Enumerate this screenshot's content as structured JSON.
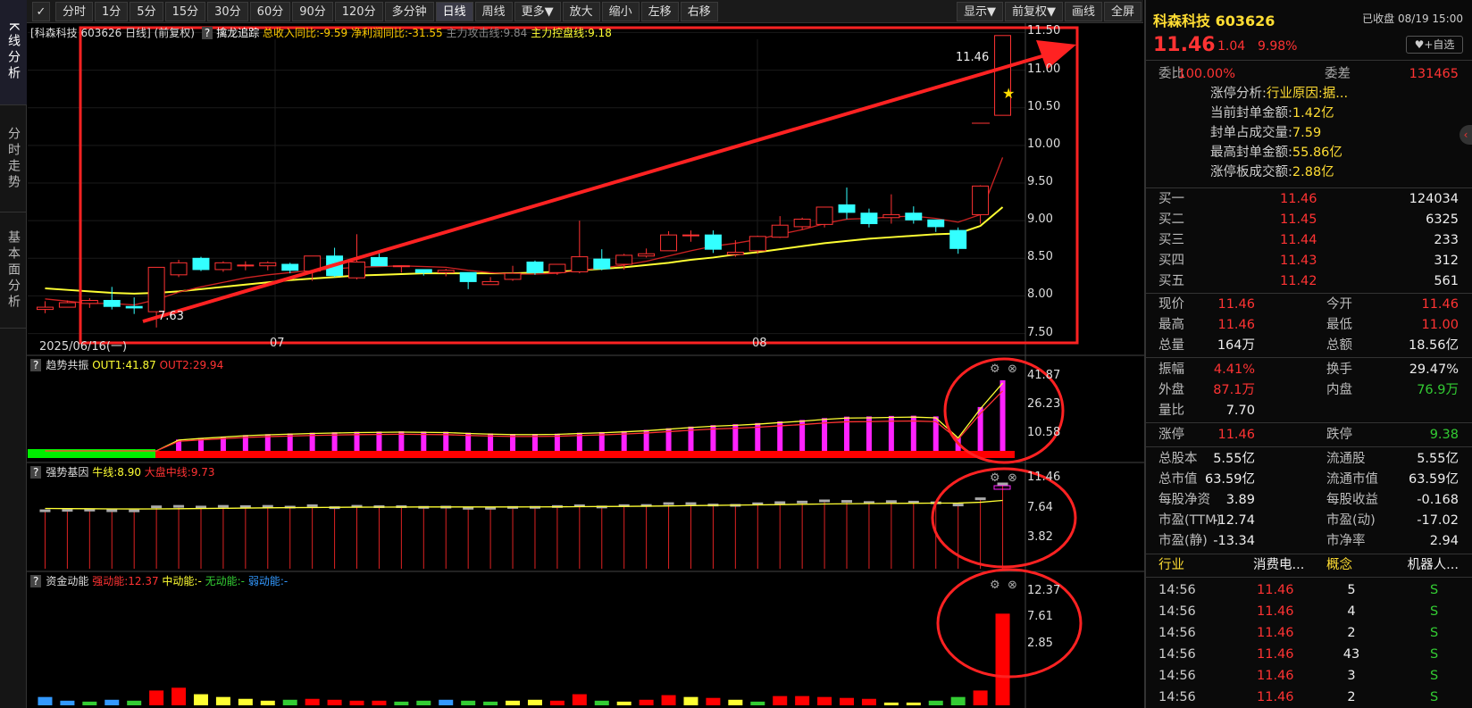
{
  "left_tabs": [
    "K线分析",
    "分时走势",
    "基本面分析"
  ],
  "toolbar": {
    "icon": "✓",
    "periods": [
      "分时",
      "1分",
      "5分",
      "15分",
      "30分",
      "60分",
      "90分",
      "120分",
      "多分钟",
      "日线",
      "周线",
      "更多▼",
      "放大",
      "缩小",
      "左移",
      "右移"
    ],
    "selected": "日线",
    "right": [
      "显示▼",
      "前复权▼",
      "画线",
      "全屏"
    ]
  },
  "main_chart": {
    "title": "[科森科技 603626 日线]",
    "adjust": "(前复权)",
    "help": "?",
    "indicator": "擒龙追踪",
    "items": [
      {
        "label": "总收入同比:-9.59",
        "color": "#ffcc00"
      },
      {
        "label": "净利润同比:-31.55",
        "color": "#ffcc00"
      },
      {
        "label": "主力攻击线:9.84",
        "color": "#888888"
      },
      {
        "label": "主力控盘线:9.18",
        "color": "#ffff33"
      }
    ],
    "y_ticks": [
      "11.50",
      "11.00",
      "10.50",
      "10.00",
      "9.50",
      "9.00",
      "8.50",
      "8.00",
      "7.50"
    ],
    "high_label": "11.46",
    "low_label": "7.63",
    "x_labels": [
      "2025/06/16(一)",
      "07",
      "08"
    ]
  },
  "sub1": {
    "help": "?",
    "name": "趋势共振",
    "items": [
      {
        "label": "OUT1:41.87",
        "color": "#ffff33"
      },
      {
        "label": "OUT2:29.94",
        "color": "#ff3333"
      }
    ],
    "y_ticks": [
      "41.87",
      "26.23",
      "10.58"
    ]
  },
  "sub2": {
    "help": "?",
    "name": "强势基因",
    "items": [
      {
        "label": "牛线:8.90",
        "color": "#ffff33"
      },
      {
        "label": "大盘中线:9.73",
        "color": "#ff3333"
      }
    ],
    "y_ticks": [
      "11.46",
      "7.64",
      "3.82"
    ]
  },
  "sub3": {
    "help": "?",
    "name": "资金动能",
    "items": [
      {
        "label": "强动能:12.37",
        "color": "#ff3333"
      },
      {
        "label": "中动能:-",
        "color": "#ffff33"
      },
      {
        "label": "无动能:-",
        "color": "#33cc33"
      },
      {
        "label": "弱动能:-",
        "color": "#3399ff"
      }
    ],
    "y_ticks": [
      "12.37",
      "7.61",
      "2.85"
    ]
  },
  "chart_data": {
    "type": "candlestick",
    "x_labels": [
      "2025/06/16(一)",
      "07",
      "08"
    ],
    "ohlc": [
      [
        7.82,
        7.85,
        7.77,
        7.93
      ],
      [
        7.85,
        7.91,
        7.85,
        7.94
      ],
      [
        7.9,
        7.94,
        7.84,
        7.97
      ],
      [
        7.94,
        7.86,
        7.82,
        8.12
      ],
      [
        7.86,
        7.84,
        7.76,
        7.98
      ],
      [
        7.79,
        8.38,
        7.58,
        8.38
      ],
      [
        8.28,
        8.44,
        8.25,
        8.48
      ],
      [
        8.5,
        8.35,
        8.33,
        8.52
      ],
      [
        8.35,
        8.44,
        8.32,
        8.46
      ],
      [
        8.4,
        8.41,
        8.34,
        8.46
      ],
      [
        8.4,
        8.44,
        8.34,
        8.46
      ],
      [
        8.42,
        8.34,
        8.3,
        8.44
      ],
      [
        8.33,
        8.53,
        8.2,
        8.53
      ],
      [
        8.53,
        8.27,
        8.25,
        8.64
      ],
      [
        8.24,
        8.45,
        8.22,
        8.82
      ],
      [
        8.51,
        8.4,
        8.4,
        8.59
      ],
      [
        8.39,
        8.4,
        8.31,
        8.4
      ],
      [
        8.35,
        8.31,
        8.27,
        8.35
      ],
      [
        8.31,
        8.34,
        8.26,
        8.36
      ],
      [
        8.31,
        8.19,
        8.09,
        8.31
      ],
      [
        8.15,
        8.19,
        8.15,
        8.25
      ],
      [
        8.22,
        8.3,
        8.2,
        8.4
      ],
      [
        8.45,
        8.31,
        8.28,
        8.47
      ],
      [
        8.31,
        8.42,
        8.28,
        8.42
      ],
      [
        8.32,
        8.52,
        8.3,
        9.0
      ],
      [
        8.49,
        8.36,
        8.34,
        8.62
      ],
      [
        8.42,
        8.54,
        8.35,
        8.56
      ],
      [
        8.53,
        8.56,
        8.51,
        8.63
      ],
      [
        8.6,
        8.81,
        8.6,
        8.86
      ],
      [
        8.81,
        8.81,
        8.72,
        8.87
      ],
      [
        8.81,
        8.62,
        8.57,
        8.87
      ],
      [
        8.55,
        8.58,
        8.52,
        8.74
      ],
      [
        8.6,
        8.79,
        8.56,
        8.8
      ],
      [
        8.78,
        8.94,
        8.77,
        9.06
      ],
      [
        8.92,
        9.02,
        8.88,
        9.04
      ],
      [
        8.95,
        9.18,
        8.91,
        9.18
      ],
      [
        9.21,
        9.11,
        9.02,
        9.44
      ],
      [
        9.1,
        8.96,
        8.91,
        9.16
      ],
      [
        9.04,
        9.08,
        8.96,
        9.35
      ],
      [
        9.1,
        9.01,
        8.96,
        9.19
      ],
      [
        9.01,
        8.92,
        8.85,
        9.01
      ],
      [
        8.87,
        8.63,
        8.56,
        8.91
      ],
      [
        9.08,
        9.46,
        8.96,
        9.47
      ],
      [
        10.4,
        11.46,
        11.0,
        11.46
      ]
    ],
    "ma_fast": [
      7.96,
      7.93,
      7.9,
      7.9,
      7.88,
      7.95,
      8.05,
      8.12,
      8.18,
      8.24,
      8.28,
      8.31,
      8.34,
      8.36,
      8.38,
      8.39,
      8.4,
      8.39,
      8.38,
      8.34,
      8.31,
      8.29,
      8.29,
      8.3,
      8.34,
      8.37,
      8.41,
      8.46,
      8.53,
      8.6,
      8.66,
      8.7,
      8.75,
      8.82,
      8.88,
      8.96,
      9.02,
      9.03,
      9.05,
      9.06,
      9.03,
      8.98,
      9.08,
      9.84
    ],
    "ma_slow": [
      8.1,
      8.08,
      8.06,
      8.04,
      8.03,
      8.04,
      8.06,
      8.09,
      8.12,
      8.15,
      8.18,
      8.21,
      8.23,
      8.25,
      8.27,
      8.28,
      8.29,
      8.3,
      8.3,
      8.3,
      8.3,
      8.3,
      8.31,
      8.32,
      8.34,
      8.36,
      8.38,
      8.41,
      8.44,
      8.48,
      8.51,
      8.55,
      8.58,
      8.62,
      8.66,
      8.7,
      8.73,
      8.76,
      8.78,
      8.8,
      8.82,
      8.83,
      8.93,
      9.18
    ],
    "y_range": [
      7.4,
      11.6
    ],
    "sub1_hist": [
      1.87,
      29.94
    ],
    "sub1_out1_last": 41.87,
    "sub1_out2_last": 29.94,
    "sub3_last": 12.37
  },
  "quote": {
    "name": "科森科技",
    "code": "603626",
    "status": "已收盘",
    "date": "08/19 15:00",
    "price": "11.46",
    "change": "1.04",
    "pct": "9.98%",
    "add_btn": "+自选",
    "weibi_label": "委比",
    "weibi": "100.00%",
    "weicha_label": "委差",
    "weicha": "131465",
    "limit_lines": [
      {
        "label": "涨停分析:",
        "value": "行业原因:据...",
        "color": "#ffdd33"
      },
      {
        "label": "当前封单金额:",
        "value": "1.42亿",
        "color": "#ffdd33"
      },
      {
        "label": "封单占成交量:",
        "value": "7.59",
        "color": "#ffdd33"
      },
      {
        "label": "最高封单金额:",
        "value": "55.86亿",
        "color": "#ffdd33"
      },
      {
        "label": "涨停板成交额:",
        "value": "2.88亿",
        "color": "#ffdd33"
      }
    ],
    "bids": [
      {
        "label": "买一",
        "price": "11.46",
        "vol": "124034"
      },
      {
        "label": "买二",
        "price": "11.45",
        "vol": "6325"
      },
      {
        "label": "买三",
        "price": "11.44",
        "vol": "233"
      },
      {
        "label": "买四",
        "price": "11.43",
        "vol": "312"
      },
      {
        "label": "买五",
        "price": "11.42",
        "vol": "561"
      }
    ],
    "stats1": [
      [
        "现价",
        "11.46",
        "今开",
        "11.46",
        "red",
        "red"
      ],
      [
        "最高",
        "11.46",
        "最低",
        "11.00",
        "red",
        "red"
      ],
      [
        "总量",
        "164万",
        "总额",
        "18.56亿",
        "wht",
        "wht"
      ]
    ],
    "stats2": [
      [
        "振幅",
        "4.41%",
        "换手",
        "29.47%",
        "red",
        "wht"
      ],
      [
        "外盘",
        "87.1万",
        "内盘",
        "76.9万",
        "red",
        "grn"
      ],
      [
        "量比",
        "7.70",
        "",
        "",
        "wht",
        "wht"
      ]
    ],
    "stats3": [
      [
        "涨停",
        "11.46",
        "跌停",
        "9.38",
        "red",
        "grn"
      ]
    ],
    "stats4": [
      [
        "总股本",
        "5.55亿",
        "流通股",
        "5.55亿",
        "wht",
        "wht"
      ],
      [
        "总市值",
        "63.59亿",
        "流通市值",
        "63.59亿",
        "wht",
        "wht"
      ],
      [
        "每股净资",
        "3.89",
        "每股收益",
        "-0.168",
        "wht",
        "wht"
      ],
      [
        "市盈(TTM)",
        "-12.74",
        "市盈(动)",
        "-17.02",
        "wht",
        "wht"
      ],
      [
        "市盈(静)",
        "-13.34",
        "市净率",
        "2.94",
        "wht",
        "wht"
      ]
    ],
    "industry": {
      "label": "行业",
      "value": "消费电...",
      "concept_label": "概念",
      "concept": "机器人..."
    },
    "ticks": [
      [
        "14:56",
        "11.46",
        "5",
        "S"
      ],
      [
        "14:56",
        "11.46",
        "4",
        "S"
      ],
      [
        "14:56",
        "11.46",
        "2",
        "S"
      ],
      [
        "14:56",
        "11.46",
        "43",
        "S"
      ],
      [
        "14:56",
        "11.46",
        "3",
        "S"
      ],
      [
        "14:56",
        "11.46",
        "2",
        "S"
      ]
    ]
  }
}
